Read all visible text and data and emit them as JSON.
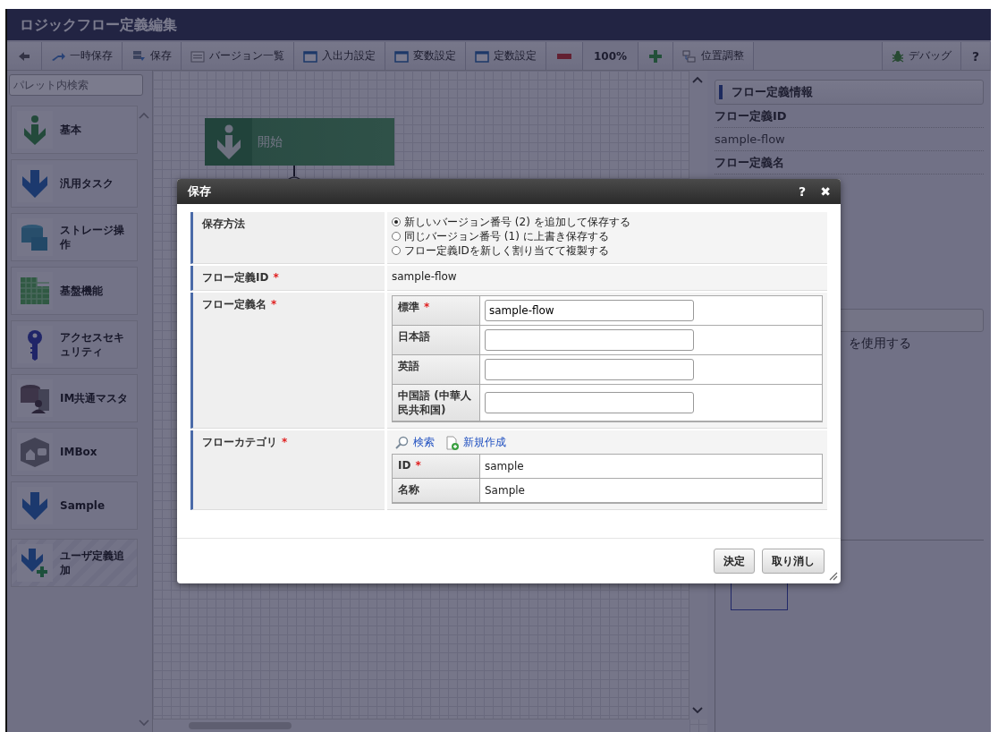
{
  "window": {
    "title": "ロジックフロー定義編集"
  },
  "toolbar": {
    "actions": [
      {
        "label": "一時保存"
      },
      {
        "label": "保存"
      },
      {
        "label": "バージョン一覧"
      },
      {
        "label": "入出力設定"
      },
      {
        "label": "変数設定"
      },
      {
        "label": "定数設定"
      }
    ],
    "zoom": "100%",
    "arrange": "位置調整",
    "debug": "デバッグ",
    "help": "?"
  },
  "palette": {
    "search": {
      "placeholder": "パレット内検索"
    },
    "items": [
      {
        "kind": "category",
        "label": "基本"
      },
      {
        "kind": "category",
        "label": "汎用タスク"
      },
      {
        "kind": "category",
        "label": "ストレージ操作"
      },
      {
        "kind": "category",
        "label": "基盤機能"
      },
      {
        "kind": "category",
        "label": "アクセスセキュリティ"
      },
      {
        "kind": "category",
        "label": "IM共通マスタ"
      },
      {
        "kind": "category",
        "label": "IMBox"
      },
      {
        "kind": "category",
        "label": "Sample"
      },
      {
        "kind": "add",
        "label": "ユーザ定義追加"
      }
    ]
  },
  "canvas": {
    "nodes": [
      {
        "label": "開始"
      }
    ]
  },
  "properties": {
    "title": "フロー定義情報",
    "rows": [
      {
        "kind": "heading",
        "text": "フロー定義ID"
      },
      {
        "kind": "value",
        "text": "sample-flow"
      },
      {
        "kind": "heading",
        "text": "フロー定義名"
      }
    ],
    "partial_text": "を使用する"
  },
  "dialog": {
    "title": "保存",
    "help": "?",
    "close": "✖",
    "required_mark": "*",
    "save_method": {
      "label": "保存方法",
      "options": [
        {
          "label": "新しいバージョン番号 (2) を追加して保存する",
          "selected": true
        },
        {
          "label": "同じバージョン番号 (1) に上書き保存する",
          "selected": false
        },
        {
          "label": "フロー定義IDを新しく割り当てて複製する",
          "selected": false
        }
      ]
    },
    "flow_id": {
      "label": "フロー定義ID",
      "required": true,
      "value": "sample-flow"
    },
    "flow_name": {
      "label": "フロー定義名",
      "required": true,
      "languages": [
        {
          "label": "標準",
          "required": true,
          "value": "sample-flow"
        },
        {
          "label": "日本語",
          "required": false
        },
        {
          "label": "英語",
          "required": false
        },
        {
          "label": "中国語 (中華人民共和国)",
          "required": false
        }
      ]
    },
    "category": {
      "label": "フローカテゴリ",
      "required": true,
      "links": [
        {
          "label": "検索"
        },
        {
          "label": "新規作成"
        }
      ],
      "fields": [
        {
          "label": "ID",
          "required": true,
          "value": "sample"
        },
        {
          "label": "名称",
          "required": false,
          "value": "Sample"
        }
      ]
    },
    "buttons": [
      {
        "label": "決定"
      },
      {
        "label": "取り消し"
      }
    ]
  }
}
